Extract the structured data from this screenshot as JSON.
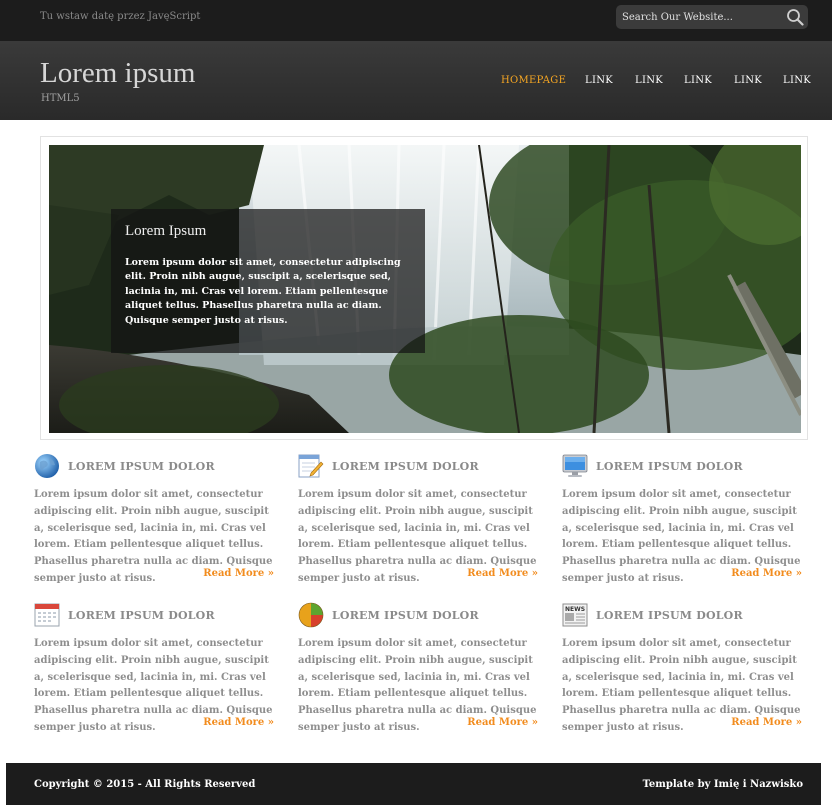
{
  "topbar": {
    "date_text": "Tu wstaw datę przez JavęScript",
    "search_placeholder": "Search Our Website..."
  },
  "header": {
    "logo": "Lorem ipsum",
    "tagline": "HTML5",
    "nav": [
      {
        "label": "HOMEPAGE",
        "active": true
      },
      {
        "label": "LINK",
        "active": false
      },
      {
        "label": "LINK",
        "active": false
      },
      {
        "label": "LINK",
        "active": false
      },
      {
        "label": "LINK",
        "active": false
      },
      {
        "label": "LINK",
        "active": false
      }
    ]
  },
  "slider": {
    "title": "Lorem Ipsum",
    "text": "Lorem ipsum dolor sit amet, consectetur adipiscing elit. Proin nibh augue, suscipit a, scelerisque sed, lacinia in, mi. Cras vel lorem. Etiam pellentesque aliquet tellus. Phasellus pharetra nulla ac diam. Quisque semper justo at risus."
  },
  "features": [
    {
      "icon": "globe-icon",
      "title": "LOREM IPSUM DOLOR",
      "text": "Lorem ipsum dolor sit amet, consectetur adipiscing elit. Proin nibh augue, suscipit a, scelerisque sed, lacinia in, mi. Cras vel lorem. Etiam pellentesque aliquet tellus. Phasellus pharetra nulla ac diam. Quisque semper justo at risus.",
      "more": "Read More »"
    },
    {
      "icon": "notepad-pencil-icon",
      "title": "LOREM IPSUM DOLOR",
      "text": "Lorem ipsum dolor sit amet, consectetur adipiscing elit. Proin nibh augue, suscipit a, scelerisque sed, lacinia in, mi. Cras vel lorem. Etiam pellentesque aliquet tellus. Phasellus pharetra nulla ac diam. Quisque semper justo at risus.",
      "more": "Read More »"
    },
    {
      "icon": "monitor-icon",
      "title": "LOREM IPSUM DOLOR",
      "text": "Lorem ipsum dolor sit amet, consectetur adipiscing elit. Proin nibh augue, suscipit a, scelerisque sed, lacinia in, mi. Cras vel lorem. Etiam pellentesque aliquet tellus. Phasellus pharetra nulla ac diam. Quisque semper justo at risus.",
      "more": "Read More »"
    },
    {
      "icon": "calendar-icon",
      "title": "LOREM IPSUM DOLOR",
      "text": "Lorem ipsum dolor sit amet, consectetur adipiscing elit. Proin nibh augue, suscipit a, scelerisque sed, lacinia in, mi. Cras vel lorem. Etiam pellentesque aliquet tellus. Phasellus pharetra nulla ac diam. Quisque semper justo at risus.",
      "more": "Read More »"
    },
    {
      "icon": "pie-chart-icon",
      "title": "LOREM IPSUM DOLOR",
      "text": "Lorem ipsum dolor sit amet, consectetur adipiscing elit. Proin nibh augue, suscipit a, scelerisque sed, lacinia in, mi. Cras vel lorem. Etiam pellentesque aliquet tellus. Phasellus pharetra nulla ac diam. Quisque semper justo at risus.",
      "more": "Read More »"
    },
    {
      "icon": "newspaper-icon",
      "news_label": "NEWS",
      "title": "LOREM IPSUM DOLOR",
      "text": "Lorem ipsum dolor sit amet, consectetur adipiscing elit. Proin nibh augue, suscipit a, scelerisque sed, lacinia in, mi. Cras vel lorem. Etiam pellentesque aliquet tellus. Phasellus pharetra nulla ac diam. Quisque semper justo at risus.",
      "more": "Read More »"
    }
  ],
  "footer": {
    "copyright": "Copyright © 2015 - All Rights Reserved",
    "credit": "Template by Imię i Nazwisko"
  },
  "colors": {
    "accent": "#f5a623",
    "link": "#f28c1e",
    "dark": "#1c1c1c"
  }
}
